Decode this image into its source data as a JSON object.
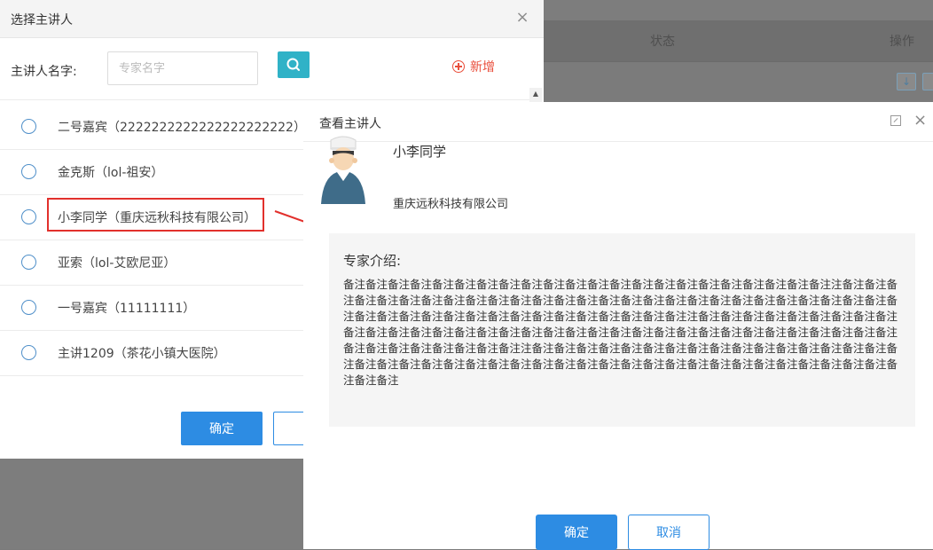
{
  "background_table": {
    "col_status": "状态",
    "col_ops": "操作"
  },
  "select_dialog": {
    "title": "选择主讲人",
    "close": "×",
    "search_label": "主讲人名字:",
    "search_placeholder": "专家名字",
    "search_value": "",
    "add_label": "新增",
    "items": [
      {
        "label": "二号嘉宾（2222222222222222222222）"
      },
      {
        "label": "金克斯（lol-祖安）"
      },
      {
        "label": "小李同学（重庆远秋科技有限公司）"
      },
      {
        "label": "亚索（lol-艾欧尼亚）"
      },
      {
        "label": "一号嘉宾（11111111）"
      },
      {
        "label": "主讲1209（茶花小镇大医院）"
      }
    ],
    "ok_label": "确定"
  },
  "view_dialog": {
    "title": "查看主讲人",
    "close": "×",
    "expert_name": "小李同学",
    "expert_org": "重庆远秋科技有限公司",
    "intro_heading": "专家介绍:",
    "intro_text": "备注备注备注备注备注备注备注备注备注备注备注备注备注备注备注备注备注备注备注备注备注备注注备注备注备注备注备注备注备注备注备注备注备注备注备注备注备注备注备注备注备注备注备注备注备注备注备注备注备注备注备注备注备注备注备注备注备注备注备注备注备注备注备注备注备注注备注备注备注备注备注备注备注备注备注备注备注备注备注备注备注备注备注备注备注备注备注备注备注备注备注备注备注备注备注备注备注备注备注备注备注备注备注备注备注备注备注备注注备注备注备注备注备注备注备注备注备注备注备注备注备注备注备注备注备注备注备注备注备注备注备注备注备注备注备注备注备注备注备注备注备注备注备注备注备注备注备注备注备注备注备注备注",
    "ok_label": "确定",
    "cancel_label": "取消"
  },
  "colors": {
    "primary": "#2d8ce3",
    "search_button": "#30b2c7",
    "add_link": "#e94e3b",
    "highlight": "#e2302c"
  }
}
